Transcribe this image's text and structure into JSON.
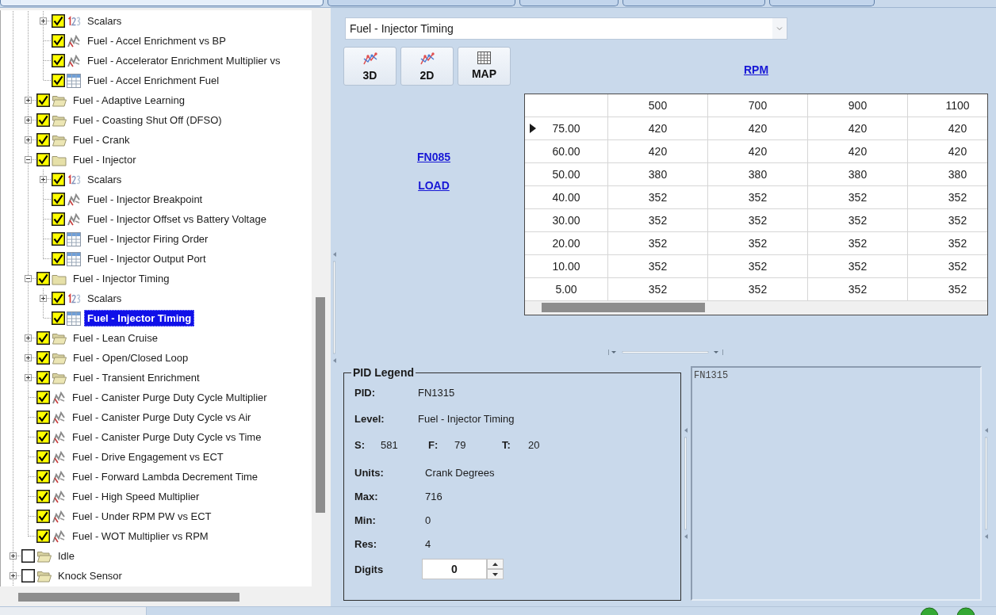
{
  "tabs": [
    {
      "selected": true
    },
    {
      "selected": false
    },
    {
      "selected": false
    },
    {
      "selected": false
    },
    {
      "selected": false
    }
  ],
  "tree": {
    "items": [
      {
        "children": [
          {
            "children": [
              {
                "label": "Scalars",
                "kind": "scalars",
                "checked": true,
                "expanded": false,
                "selected": false
              },
              {
                "label": "Fuel - Accel Enrichment vs BP",
                "kind": "curve",
                "checked": true,
                "selected": false
              },
              {
                "label": "Fuel - Accelerator Enrichment Multiplier vs",
                "kind": "curve",
                "checked": true,
                "selected": false
              },
              {
                "label": "Fuel - Accel Enrichment Fuel",
                "kind": "table",
                "checked": true,
                "selected": false
              }
            ]
          },
          {
            "label": "Fuel - Adaptive Learning",
            "kind": "folder",
            "checked": true,
            "expanded": false,
            "selected": false
          },
          {
            "label": "Fuel - Coasting Shut Off (DFSO)",
            "kind": "folder",
            "checked": true,
            "expanded": false,
            "selected": false
          },
          {
            "label": "Fuel - Crank",
            "kind": "folder",
            "checked": true,
            "expanded": false,
            "selected": false
          },
          {
            "label": "Fuel - Injector",
            "kind": "folder",
            "checked": true,
            "expanded": true,
            "selected": false,
            "children": [
              {
                "label": "Scalars",
                "kind": "scalars",
                "checked": true,
                "expanded": false,
                "selected": false
              },
              {
                "label": "Fuel - Injector Breakpoint",
                "kind": "curve",
                "checked": true,
                "selected": false
              },
              {
                "label": "Fuel - Injector Offset vs Battery Voltage",
                "kind": "curve",
                "checked": true,
                "selected": false
              },
              {
                "label": "Fuel - Injector Firing Order",
                "kind": "table",
                "checked": true,
                "selected": false
              },
              {
                "label": "Fuel - Injector Output Port",
                "kind": "table",
                "checked": true,
                "selected": false
              }
            ]
          },
          {
            "label": "Fuel - Injector Timing",
            "kind": "folder",
            "checked": true,
            "expanded": true,
            "selected": false,
            "children": [
              {
                "label": "Scalars",
                "kind": "scalars",
                "checked": true,
                "expanded": false,
                "selected": false
              },
              {
                "label": "Fuel - Injector Timing",
                "kind": "table",
                "checked": true,
                "selected": true
              }
            ]
          },
          {
            "label": "Fuel - Lean Cruise",
            "kind": "folder",
            "checked": true,
            "expanded": false,
            "selected": false
          },
          {
            "label": "Fuel - Open/Closed Loop",
            "kind": "folder",
            "checked": true,
            "expanded": false,
            "selected": false
          },
          {
            "label": "Fuel - Transient Enrichment",
            "kind": "folder",
            "checked": true,
            "expanded": false,
            "selected": false
          },
          {
            "label": "Fuel - Canister Purge Duty Cycle Multiplier",
            "kind": "curve",
            "checked": true,
            "selected": false
          },
          {
            "label": "Fuel - Canister Purge Duty Cycle vs Air",
            "kind": "curve",
            "checked": true,
            "selected": false
          },
          {
            "label": "Fuel - Canister Purge Duty Cycle vs Time",
            "kind": "curve",
            "checked": true,
            "selected": false
          },
          {
            "label": "Fuel - Drive Engagement vs ECT",
            "kind": "curve",
            "checked": true,
            "selected": false
          },
          {
            "label": "Fuel - Forward Lambda Decrement Time",
            "kind": "curve",
            "checked": true,
            "selected": false
          },
          {
            "label": "Fuel - High Speed Multiplier",
            "kind": "curve",
            "checked": true,
            "selected": false
          },
          {
            "label": "Fuel - Under RPM PW vs ECT",
            "kind": "curve",
            "checked": true,
            "selected": false
          },
          {
            "label": "Fuel - WOT Multiplier vs RPM",
            "kind": "curve",
            "checked": true,
            "selected": false
          }
        ]
      },
      {
        "label": "Idle",
        "kind": "folder",
        "checked": false,
        "expanded": false,
        "selected": false
      },
      {
        "label": "Knock Sensor",
        "kind": "folder",
        "checked": false,
        "expanded": false,
        "selected": false
      }
    ]
  },
  "map_selector": {
    "value": "Fuel - Injector Timing"
  },
  "view_buttons": [
    {
      "label": "3D",
      "kind": "chart"
    },
    {
      "label": "2D",
      "kind": "chart"
    },
    {
      "label": "MAP",
      "kind": "grid"
    }
  ],
  "table": {
    "column_axis": "RPM",
    "row_axis": [
      "FN085",
      "LOAD"
    ],
    "columns": [
      "500",
      "700",
      "900",
      "1100"
    ],
    "rows": [
      {
        "label": "75.00",
        "selected": true,
        "cells": [
          "420",
          "420",
          "420",
          "420"
        ]
      },
      {
        "label": "60.00",
        "selected": false,
        "cells": [
          "420",
          "420",
          "420",
          "420"
        ]
      },
      {
        "label": "50.00",
        "selected": false,
        "cells": [
          "380",
          "380",
          "380",
          "380"
        ]
      },
      {
        "label": "40.00",
        "selected": false,
        "cells": [
          "352",
          "352",
          "352",
          "352"
        ]
      },
      {
        "label": "30.00",
        "selected": false,
        "cells": [
          "352",
          "352",
          "352",
          "352"
        ]
      },
      {
        "label": "20.00",
        "selected": false,
        "cells": [
          "352",
          "352",
          "352",
          "352"
        ]
      },
      {
        "label": "10.00",
        "selected": false,
        "cells": [
          "352",
          "352",
          "352",
          "352"
        ]
      },
      {
        "label": "5.00",
        "selected": false,
        "cells": [
          "352",
          "352",
          "352",
          "352"
        ]
      }
    ]
  },
  "pid_legend": {
    "title": "PID Legend",
    "rows": [
      {
        "kind": "field",
        "label": "PID:",
        "value": "FN1315"
      },
      {
        "kind": "field",
        "label": "Level:",
        "value": "Fuel - Injector Timing"
      },
      {
        "kind": "counts",
        "items": [
          {
            "label": "S:",
            "value": "581"
          },
          {
            "label": "F:",
            "value": "79"
          },
          {
            "label": "T:",
            "value": "20"
          }
        ]
      },
      {
        "kind": "spec",
        "label": "Units:",
        "value": "Crank Degrees"
      },
      {
        "kind": "spec",
        "label": "Max:",
        "value": "716"
      },
      {
        "kind": "spec",
        "label": "Min:",
        "value": "0"
      },
      {
        "kind": "spec",
        "label": "Res:",
        "value": "4"
      },
      {
        "kind": "spinner",
        "label": "Digits",
        "value": "0"
      }
    ]
  },
  "notes": {
    "text": "FN1315"
  },
  "status_bar": {
    "lights": [
      {
        "color": "#34a834"
      },
      {
        "color": "#34a834"
      }
    ]
  }
}
